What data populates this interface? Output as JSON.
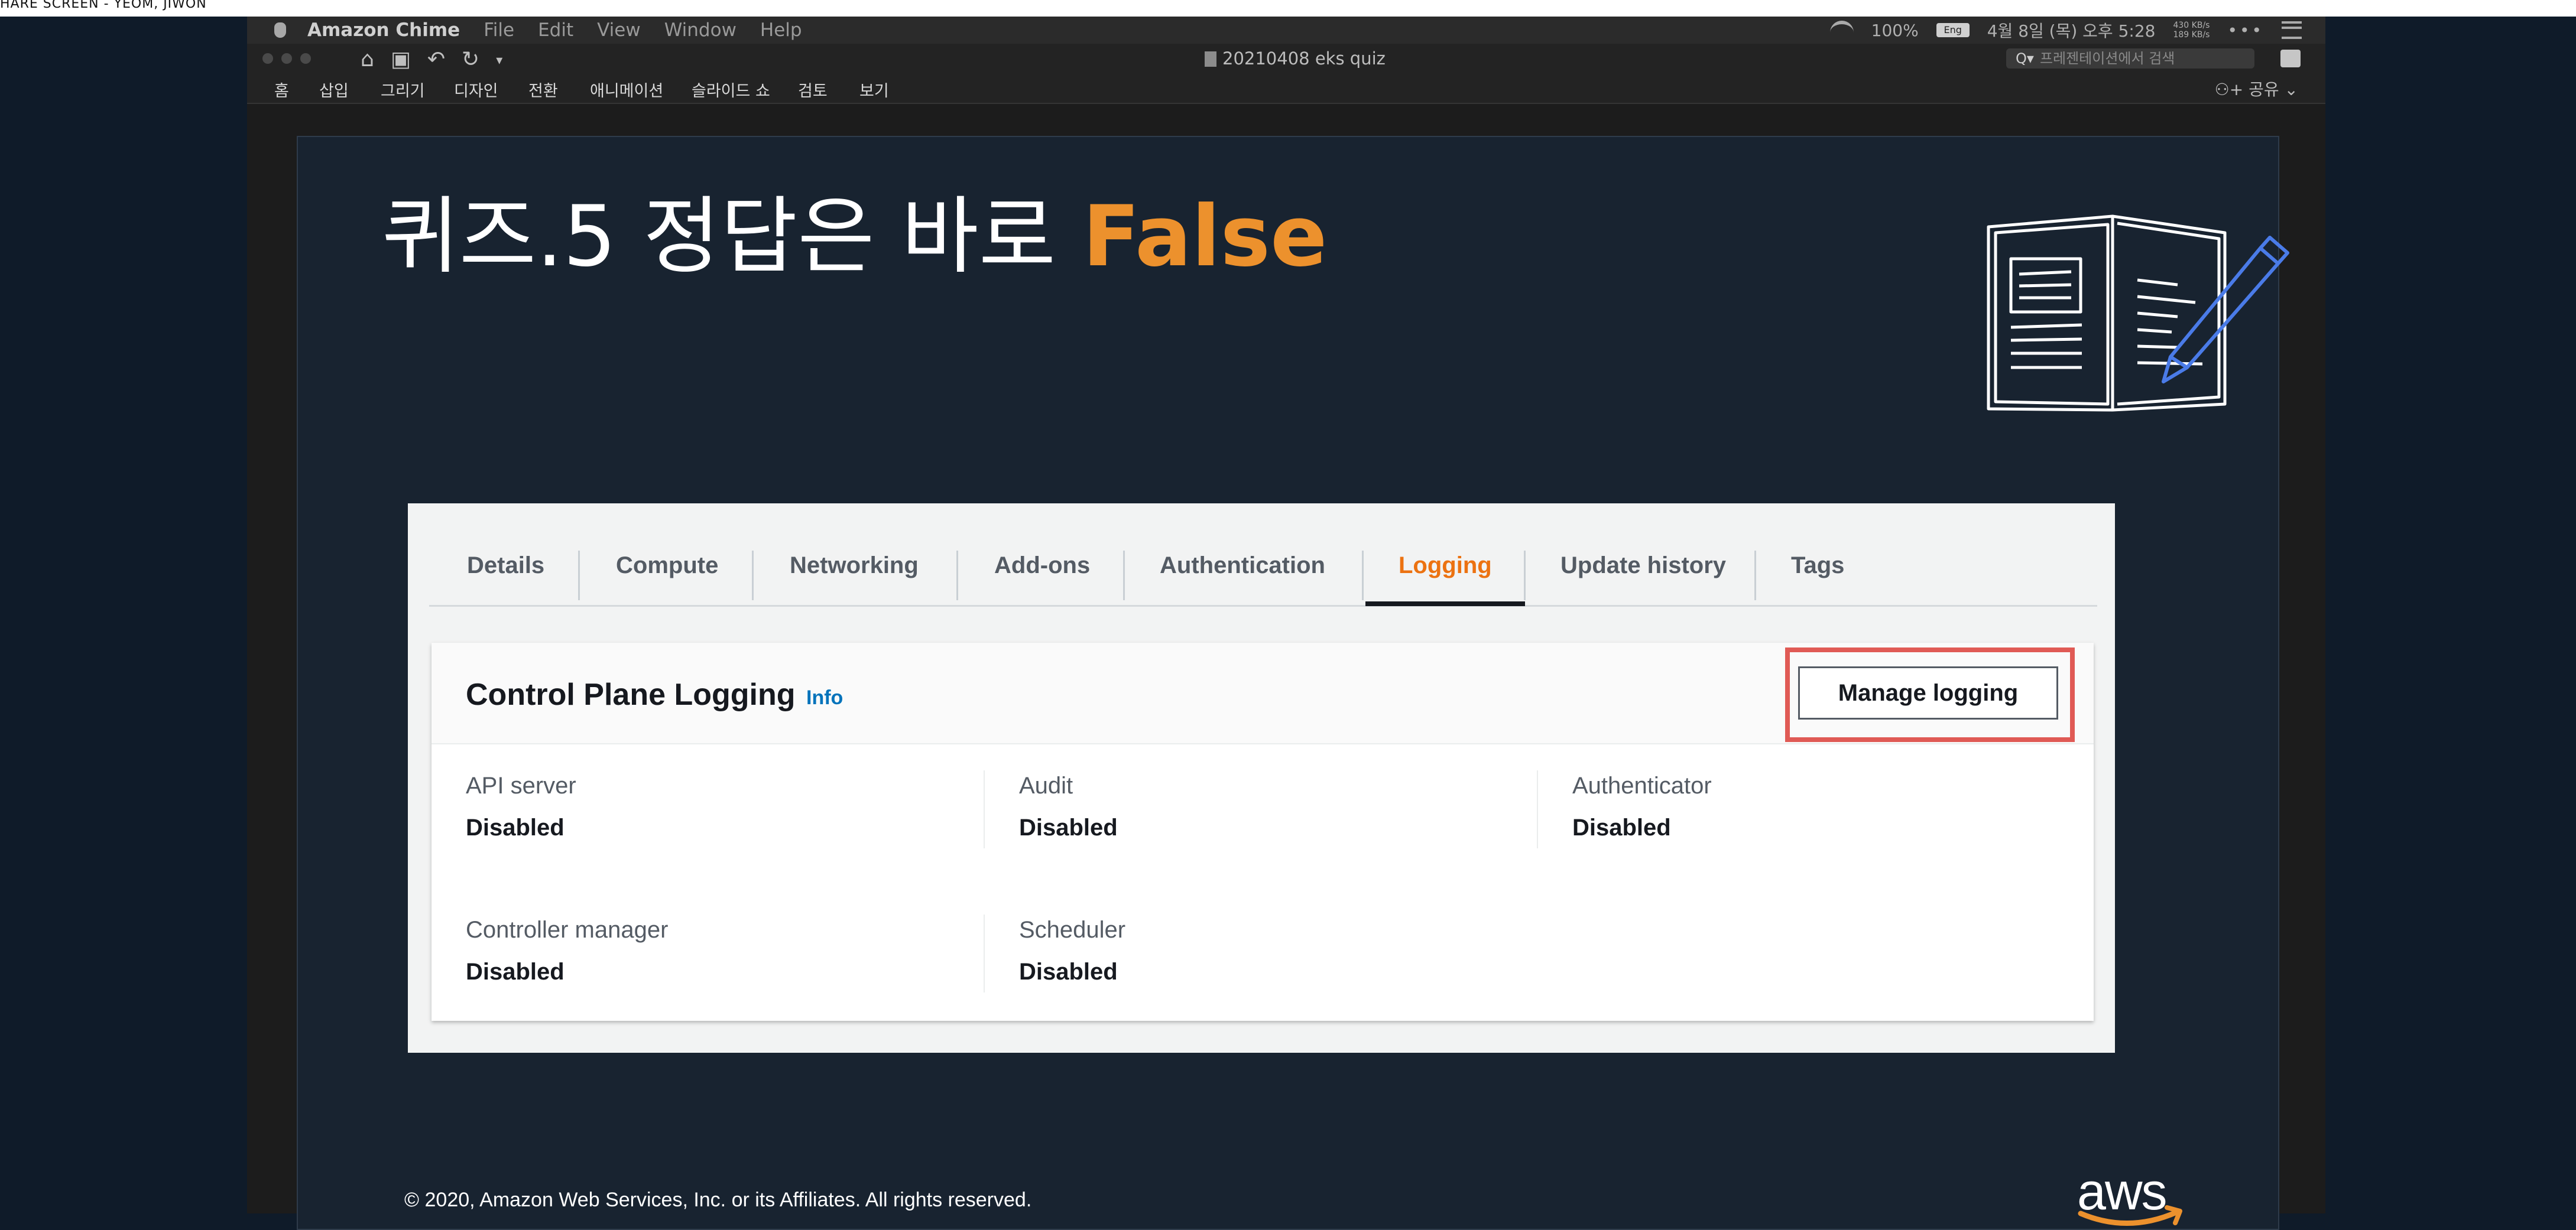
{
  "share_banner": "HARE SCREEN - YEOM, JIWON",
  "menubar": {
    "app_name": "Amazon Chime",
    "items": [
      "File",
      "Edit",
      "View",
      "Window",
      "Help"
    ],
    "battery": "100%",
    "battery_badge": "Eng",
    "datetime": "4월 8일 (목) 오후 5:28",
    "net_up": "430 KB/s",
    "net_down": "189 KB/s"
  },
  "toolbar": {
    "document_title": "20210408 eks quiz",
    "search_placeholder": "프레젠테이션에서 검색",
    "search_prefix": "Q▾"
  },
  "ribbon": {
    "tabs": [
      "홈",
      "삽입",
      "그리기",
      "디자인",
      "전환",
      "애니메이션",
      "슬라이드 쇼",
      "검토",
      "보기"
    ],
    "share_label": "공유"
  },
  "slide": {
    "title_prefix": "퀴즈.5 정답은 바로 ",
    "title_accent": "False",
    "footer": "© 2020, Amazon Web Services, Inc. or its Affiliates. All rights reserved.",
    "logo_text": "aws",
    "accent_color": "#ec912d"
  },
  "console": {
    "tabs": [
      {
        "label": "Details",
        "active": false
      },
      {
        "label": "Compute",
        "active": false
      },
      {
        "label": "Networking",
        "active": false
      },
      {
        "label": "Add-ons",
        "active": false
      },
      {
        "label": "Authentication",
        "active": false
      },
      {
        "label": "Logging",
        "active": true
      },
      {
        "label": "Update history",
        "active": false
      },
      {
        "label": "Tags",
        "active": false
      }
    ],
    "panel": {
      "title": "Control Plane Logging",
      "info": "Info",
      "manage_button": "Manage logging",
      "fields": [
        {
          "label": "API server",
          "value": "Disabled"
        },
        {
          "label": "Audit",
          "value": "Disabled"
        },
        {
          "label": "Authenticator",
          "value": "Disabled"
        },
        {
          "label": "Controller manager",
          "value": "Disabled"
        },
        {
          "label": "Scheduler",
          "value": "Disabled"
        }
      ]
    },
    "active_tab_color": "#ec7211",
    "highlight_color": "#e05a55"
  }
}
